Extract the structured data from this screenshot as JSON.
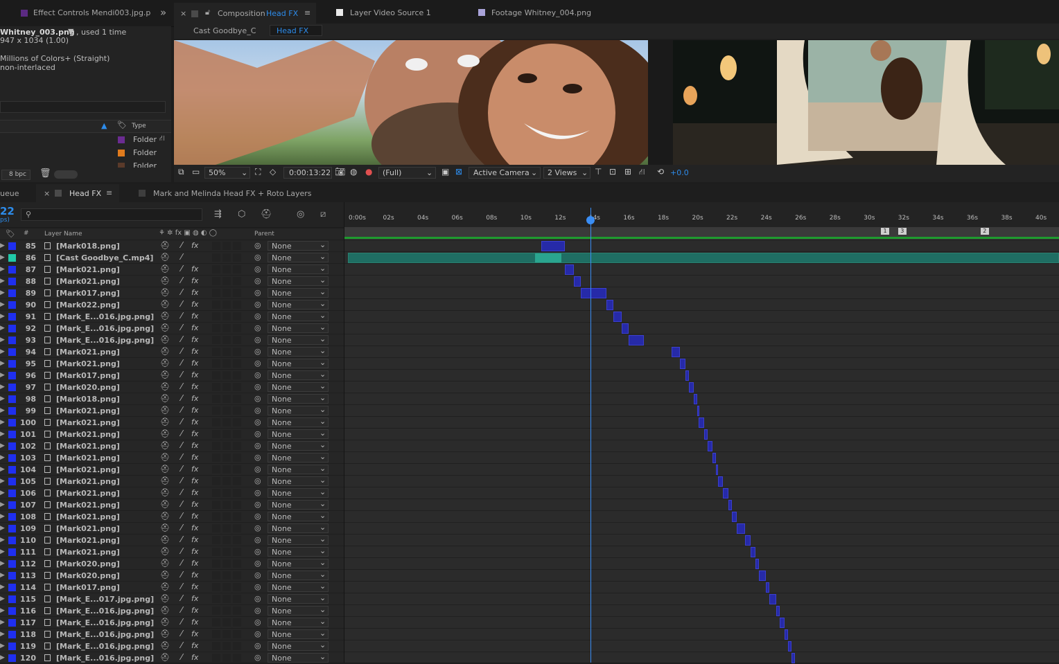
{
  "top_tabs": {
    "effect_controls": "Effect Controls Mendi003.jpg.p",
    "composition_prefix": "Composition",
    "composition_name": "Head FX",
    "layer": "Layer Video Source 1",
    "footage": "Footage Whitney_004.png",
    "overflow": "»"
  },
  "comp_breadcrumb": [
    "Cast Goodbye_C",
    "Head FX"
  ],
  "project_panel": {
    "item_name": "Whitney_003.png",
    "used": ", used 1 time",
    "dimensions": "947 x 1034 (1.00)",
    "color": "Millions of Colors+ (Straight)",
    "interlace": "non-interlaced",
    "type_header": "Type",
    "rows": [
      "Folder",
      "Folder",
      "Folder"
    ],
    "folder_colors": [
      "#6b2c91",
      "#e07b1d",
      "#5a3a2a"
    ],
    "bpc": "8 bpc"
  },
  "viewer_toolbar": {
    "zoom": "50%",
    "timecode": "0:00:13:22",
    "resolution": "(Full)",
    "camera": "Active Camera",
    "views": "2 Views",
    "exposure": "+0.0"
  },
  "timeline_tabs": {
    "queue": "ueue",
    "active": "Head FX",
    "other": "Mark and Melinda Head FX + Roto Layers"
  },
  "timeline": {
    "timecode": "22",
    "fps": "ps)",
    "search_placeholder": "",
    "col_layer_name": "Layer Name",
    "col_parent": "Parent",
    "col_hash": "#",
    "ruler_labels": [
      "0:00s",
      "02s",
      "04s",
      "06s",
      "08s",
      "10s",
      "12s",
      "14s",
      "16s",
      "18s",
      "20s",
      "22s",
      "24s",
      "26s",
      "28s",
      "30s",
      "32s",
      "34s",
      "36s",
      "38s",
      "40s"
    ],
    "markers": [
      "1",
      "3",
      "2"
    ],
    "playhead_seconds": 13.9
  },
  "layers": [
    {
      "num": "85",
      "name": "[Mark018.png]",
      "parent": "None",
      "label": "#1f2ff0",
      "fx": true,
      "start": 11.0,
      "end": 12.4
    },
    {
      "num": "86",
      "name": "[Cast Goodbye_C.mp4]",
      "parent": "None",
      "label": "#20c8a8",
      "fx": false,
      "video": true,
      "start": 0.0,
      "end": 41.0
    },
    {
      "num": "87",
      "name": "[Mark021.png]",
      "parent": "None",
      "label": "#1f2ff0",
      "fx": true,
      "start": 12.4,
      "end": 12.9
    },
    {
      "num": "88",
      "name": "[Mark021.png]",
      "parent": "None",
      "label": "#1f2ff0",
      "fx": true,
      "start": 12.9,
      "end": 13.3
    },
    {
      "num": "89",
      "name": "[Mark017.png]",
      "parent": "None",
      "label": "#1f2ff0",
      "fx": true,
      "start": 13.3,
      "end": 14.8
    },
    {
      "num": "90",
      "name": "[Mark022.png]",
      "parent": "None",
      "label": "#1f2ff0",
      "fx": true,
      "start": 14.8,
      "end": 15.2
    },
    {
      "num": "91",
      "name": "[Mark_E...016.jpg.png]",
      "parent": "None",
      "label": "#1f2ff0",
      "fx": true,
      "start": 15.2,
      "end": 15.7
    },
    {
      "num": "92",
      "name": "[Mark_E...016.jpg.png]",
      "parent": "None",
      "label": "#1f2ff0",
      "fx": true,
      "start": 15.7,
      "end": 16.1
    },
    {
      "num": "93",
      "name": "[Mark_E...016.jpg.png]",
      "parent": "None",
      "label": "#1f2ff0",
      "fx": true,
      "start": 16.1,
      "end": 17.0
    },
    {
      "num": "94",
      "name": "[Mark021.png]",
      "parent": "None",
      "label": "#1f2ff0",
      "fx": true,
      "start": 18.6,
      "end": 19.1
    },
    {
      "num": "95",
      "name": "[Mark021.png]",
      "parent": "None",
      "label": "#1f2ff0",
      "fx": true,
      "start": 19.1,
      "end": 19.4
    },
    {
      "num": "96",
      "name": "[Mark017.png]",
      "parent": "None",
      "label": "#1f2ff0",
      "fx": true,
      "start": 19.4,
      "end": 19.6
    },
    {
      "num": "97",
      "name": "[Mark020.png]",
      "parent": "None",
      "label": "#1f2ff0",
      "fx": true,
      "start": 19.6,
      "end": 19.9
    },
    {
      "num": "98",
      "name": "[Mark018.png]",
      "parent": "None",
      "label": "#1f2ff0",
      "fx": true,
      "start": 19.9,
      "end": 20.1
    },
    {
      "num": "99",
      "name": "[Mark021.png]",
      "parent": "None",
      "label": "#1f2ff0",
      "fx": true,
      "start": 20.1,
      "end": 20.2
    },
    {
      "num": "100",
      "name": "[Mark021.png]",
      "parent": "None",
      "label": "#1f2ff0",
      "fx": true,
      "start": 20.2,
      "end": 20.5
    },
    {
      "num": "101",
      "name": "[Mark021.png]",
      "parent": "None",
      "label": "#1f2ff0",
      "fx": true,
      "start": 20.5,
      "end": 20.7
    },
    {
      "num": "102",
      "name": "[Mark021.png]",
      "parent": "None",
      "label": "#1f2ff0",
      "fx": true,
      "start": 20.7,
      "end": 21.0
    },
    {
      "num": "103",
      "name": "[Mark021.png]",
      "parent": "None",
      "label": "#1f2ff0",
      "fx": true,
      "start": 21.0,
      "end": 21.2
    },
    {
      "num": "104",
      "name": "[Mark021.png]",
      "parent": "None",
      "label": "#1f2ff0",
      "fx": true,
      "start": 21.2,
      "end": 21.3
    },
    {
      "num": "105",
      "name": "[Mark021.png]",
      "parent": "None",
      "label": "#1f2ff0",
      "fx": true,
      "start": 21.3,
      "end": 21.6
    },
    {
      "num": "106",
      "name": "[Mark021.png]",
      "parent": "None",
      "label": "#1f2ff0",
      "fx": true,
      "start": 21.6,
      "end": 21.9
    },
    {
      "num": "107",
      "name": "[Mark021.png]",
      "parent": "None",
      "label": "#1f2ff0",
      "fx": true,
      "start": 21.9,
      "end": 22.1
    },
    {
      "num": "108",
      "name": "[Mark021.png]",
      "parent": "None",
      "label": "#1f2ff0",
      "fx": true,
      "start": 22.1,
      "end": 22.4
    },
    {
      "num": "109",
      "name": "[Mark021.png]",
      "parent": "None",
      "label": "#1f2ff0",
      "fx": true,
      "start": 22.4,
      "end": 22.9
    },
    {
      "num": "110",
      "name": "[Mark021.png]",
      "parent": "None",
      "label": "#1f2ff0",
      "fx": true,
      "start": 22.9,
      "end": 23.2
    },
    {
      "num": "111",
      "name": "[Mark021.png]",
      "parent": "None",
      "label": "#1f2ff0",
      "fx": true,
      "start": 23.2,
      "end": 23.5
    },
    {
      "num": "112",
      "name": "[Mark020.png]",
      "parent": "None",
      "label": "#1f2ff0",
      "fx": true,
      "start": 23.5,
      "end": 23.7
    },
    {
      "num": "113",
      "name": "[Mark020.png]",
      "parent": "None",
      "label": "#1f2ff0",
      "fx": true,
      "start": 23.7,
      "end": 24.1
    },
    {
      "num": "114",
      "name": "[Mark017.png]",
      "parent": "None",
      "label": "#1f2ff0",
      "fx": true,
      "start": 24.1,
      "end": 24.3
    },
    {
      "num": "115",
      "name": "[Mark_E...017.jpg.png]",
      "parent": "None",
      "label": "#1f2ff0",
      "fx": true,
      "start": 24.3,
      "end": 24.7
    },
    {
      "num": "116",
      "name": "[Mark_E...016.jpg.png]",
      "parent": "None",
      "label": "#1f2ff0",
      "fx": true,
      "start": 24.7,
      "end": 24.9
    },
    {
      "num": "117",
      "name": "[Mark_E...016.jpg.png]",
      "parent": "None",
      "label": "#1f2ff0",
      "fx": true,
      "start": 24.9,
      "end": 25.2
    },
    {
      "num": "118",
      "name": "[Mark_E...016.jpg.png]",
      "parent": "None",
      "label": "#1f2ff0",
      "fx": true,
      "start": 25.2,
      "end": 25.4
    },
    {
      "num": "119",
      "name": "[Mark_E...016.jpg.png]",
      "parent": "None",
      "label": "#1f2ff0",
      "fx": true,
      "start": 25.4,
      "end": 25.6
    },
    {
      "num": "120",
      "name": "[Mark_E...016.jpg.png]",
      "parent": "None",
      "label": "#1f2ff0",
      "fx": true,
      "start": 25.6,
      "end": 25.8
    }
  ],
  "colors": {
    "accent_blue": "#2d8ceb",
    "layer_bar": "#262aa8",
    "video_bar": "#1f6e63"
  }
}
